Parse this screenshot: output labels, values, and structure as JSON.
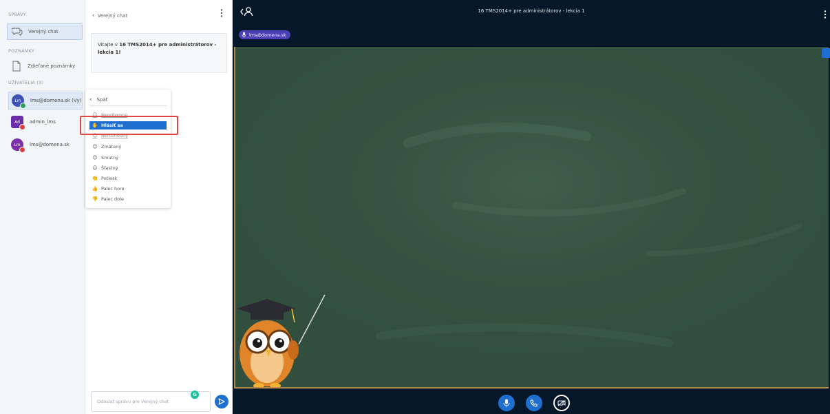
{
  "sidebar": {
    "messages_title": "SPRÁVY",
    "public_chat": "Verejný chat",
    "notes_title": "POZNÁMKY",
    "shared_notes": "Zdieľané poznámky",
    "users_title": "UŽÍVATELIA (3)",
    "users": [
      {
        "initials": "Lm",
        "name": "lms@domena.sk (Vy)",
        "color": "#3f51b5",
        "badge_color": "#2e9e5b",
        "active": true
      },
      {
        "initials": "Ad",
        "name": "admin_lms",
        "color": "#6a2fa8",
        "badge_color": "#e23b3b",
        "active": false
      },
      {
        "initials": "Lm",
        "name": "lms@domena.sk",
        "color": "#7b2fa8",
        "badge_color": "#e23b3b",
        "active": false
      }
    ]
  },
  "chat": {
    "title": "Verejný chat",
    "welcome_prefix": "Vitajte v ",
    "welcome_bold": "16 TMS2014+ pre administrátorov - lekcia 1!",
    "input_placeholder": "Odoslať správu pre Verejný chat",
    "emoji_menu": {
      "back_label": "Späť",
      "items": [
        {
          "icon": "☺",
          "label": "Neprítomný",
          "state": "dim"
        },
        {
          "icon": "✋",
          "label": "Hlásiť sa",
          "state": "selected"
        },
        {
          "icon": "☺",
          "label": "Nerozhodný",
          "state": "dim"
        },
        {
          "icon": "☺",
          "label": "Zmätený",
          "state": "normal"
        },
        {
          "icon": "☹",
          "label": "Smutný",
          "state": "normal"
        },
        {
          "icon": "☺",
          "label": "Šťastný",
          "state": "normal"
        },
        {
          "icon": "👏",
          "label": "Potlesk",
          "state": "normal"
        },
        {
          "icon": "👍",
          "label": "Palec hore",
          "state": "normal"
        },
        {
          "icon": "👎",
          "label": "Palec dole",
          "state": "normal"
        }
      ]
    }
  },
  "presentation": {
    "title": "16 TMS2014+ pre administrátorov - lekcia 1",
    "talker": "lms@domena.sk"
  },
  "colors": {
    "accent": "#1e6fcf",
    "board": "#324f3d",
    "topbar": "#06172a",
    "highlight": "#e04545"
  }
}
